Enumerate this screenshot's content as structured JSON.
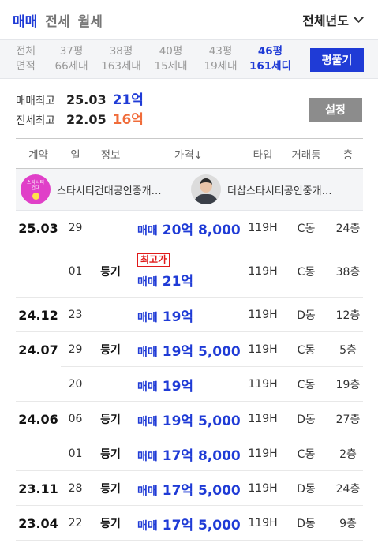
{
  "tabs": [
    {
      "label": "매매",
      "active": true
    },
    {
      "label": "전세",
      "active": false
    },
    {
      "label": "월세",
      "active": false
    }
  ],
  "year_filter": {
    "label": "전체년도"
  },
  "size_filter": {
    "first": {
      "line1": "전체",
      "line2": "면적"
    },
    "options": [
      {
        "size": "37평",
        "households": "66세대",
        "selected": false
      },
      {
        "size": "38평",
        "households": "163세대",
        "selected": false
      },
      {
        "size": "40평",
        "households": "15세대",
        "selected": false
      },
      {
        "size": "43평",
        "households": "19세대",
        "selected": false
      },
      {
        "size": "46평",
        "households": "161세디",
        "selected": true
      }
    ],
    "unfold_button": "평풀기"
  },
  "summary": {
    "sale": {
      "label": "매매최고",
      "date": "25.03",
      "price": "21억"
    },
    "lease": {
      "label": "전세최고",
      "date": "22.05",
      "price": "16억"
    },
    "settings_button": "설정"
  },
  "table": {
    "headers": {
      "date": "계약",
      "day": "일",
      "info": "정보",
      "price": "가격↓",
      "type": "타입",
      "dong": "거래동",
      "floor": "층"
    },
    "agents": [
      {
        "name": "스타시티건대공인중개…",
        "avatar_text1": "스타시티",
        "avatar_text2": "건대"
      },
      {
        "name": "더샵스타시티공인중개…"
      }
    ],
    "rows": [
      {
        "date": "25.03",
        "day": "29",
        "info": "",
        "badge": "",
        "kind": "매매",
        "price": "20억 8,000",
        "type": "119H",
        "dong": "C동",
        "floor": "24층"
      },
      {
        "date": "",
        "day": "01",
        "info": "등기",
        "badge": "최고가",
        "kind": "매매",
        "price": "21억",
        "type": "119H",
        "dong": "C동",
        "floor": "38층"
      },
      {
        "date": "24.12",
        "day": "23",
        "info": "",
        "badge": "",
        "kind": "매매",
        "price": "19억",
        "type": "119H",
        "dong": "D동",
        "floor": "12층"
      },
      {
        "date": "24.07",
        "day": "29",
        "info": "등기",
        "badge": "",
        "kind": "매매",
        "price": "19억 5,000",
        "type": "119H",
        "dong": "C동",
        "floor": "5층"
      },
      {
        "date": "",
        "day": "20",
        "info": "",
        "badge": "",
        "kind": "매매",
        "price": "19억",
        "type": "119H",
        "dong": "C동",
        "floor": "19층"
      },
      {
        "date": "24.06",
        "day": "06",
        "info": "등기",
        "badge": "",
        "kind": "매매",
        "price": "19억 5,000",
        "type": "119H",
        "dong": "D동",
        "floor": "27층"
      },
      {
        "date": "",
        "day": "01",
        "info": "등기",
        "badge": "",
        "kind": "매매",
        "price": "17억 8,000",
        "type": "119H",
        "dong": "C동",
        "floor": "2층"
      },
      {
        "date": "23.11",
        "day": "28",
        "info": "등기",
        "badge": "",
        "kind": "매매",
        "price": "17억 5,000",
        "type": "119H",
        "dong": "D동",
        "floor": "24층"
      },
      {
        "date": "23.04",
        "day": "22",
        "info": "등기",
        "badge": "",
        "kind": "매매",
        "price": "17억 5,000",
        "type": "119H",
        "dong": "D동",
        "floor": "9층"
      }
    ]
  },
  "colors": {
    "accent": "#1f3bd6",
    "lease": "#f06c3a",
    "badge": "#e01a1a"
  }
}
